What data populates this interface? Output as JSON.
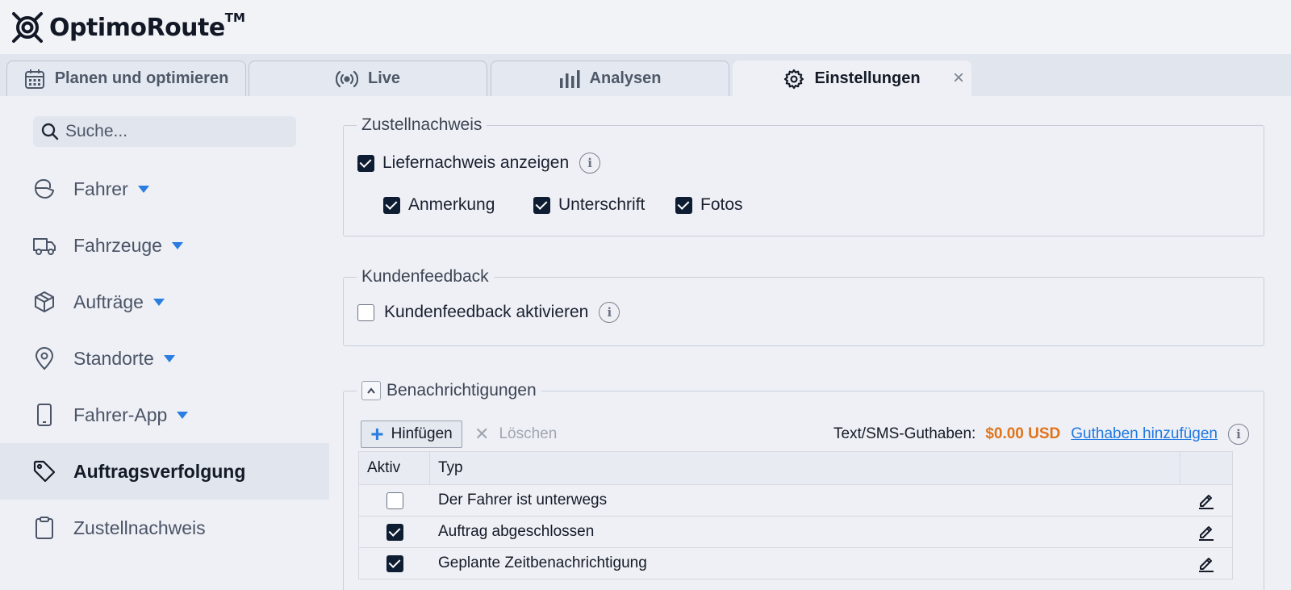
{
  "app": {
    "name": "OptimoRoute",
    "trademark": "TM"
  },
  "tabs": [
    {
      "label": "Planen und optimieren",
      "icon": "calendar-icon",
      "active": false
    },
    {
      "label": "Live",
      "icon": "broadcast-icon",
      "active": false
    },
    {
      "label": "Analysen",
      "icon": "bar-chart-icon",
      "active": false
    },
    {
      "label": "Einstellungen",
      "icon": "gear-icon",
      "active": true,
      "close": "×"
    }
  ],
  "sidebar": {
    "search_placeholder": "Suche...",
    "items": [
      {
        "label": "Fahrer",
        "icon": "driver-icon",
        "has_caret": true
      },
      {
        "label": "Fahrzeuge",
        "icon": "truck-icon",
        "has_caret": true
      },
      {
        "label": "Aufträge",
        "icon": "package-icon",
        "has_caret": true
      },
      {
        "label": "Standorte",
        "icon": "map-pin-icon",
        "has_caret": true
      },
      {
        "label": "Fahrer-App",
        "icon": "phone-icon",
        "has_caret": true
      },
      {
        "label": "Auftragsverfolgung",
        "icon": "tag-icon",
        "has_caret": false,
        "active": true
      },
      {
        "label": "Zustellnachweis",
        "icon": "clipboard-icon",
        "has_caret": false
      }
    ]
  },
  "proof_of_delivery": {
    "title": "Zustellnachweis",
    "show_label": "Liefernachweis anzeigen",
    "show_checked": true,
    "options": [
      {
        "label": "Anmerkung",
        "checked": true
      },
      {
        "label": "Unterschrift",
        "checked": true
      },
      {
        "label": "Fotos",
        "checked": true
      }
    ]
  },
  "customer_feedback": {
    "title": "Kundenfeedback",
    "enable_label": "Kundenfeedback aktivieren",
    "enabled": false
  },
  "notifications": {
    "title": "Benachrichtigungen",
    "add_label": "Hinfügen",
    "delete_label": "Löschen",
    "credit_label": "Text/SMS-Guthaben:",
    "credit_amount": "$0.00 USD",
    "add_credit_link": "Guthaben hinzufügen",
    "columns": {
      "active": "Aktiv",
      "type": "Typ"
    },
    "rows": [
      {
        "active": false,
        "type": "Der Fahrer ist unterwegs"
      },
      {
        "active": true,
        "type": "Auftrag abgeschlossen"
      },
      {
        "active": true,
        "type": "Geplante Zeitbenachrichtigung"
      }
    ]
  },
  "colors": {
    "accent": "#2a7de1",
    "credit": "#e0731a",
    "checkbox": "#0f1d33"
  }
}
